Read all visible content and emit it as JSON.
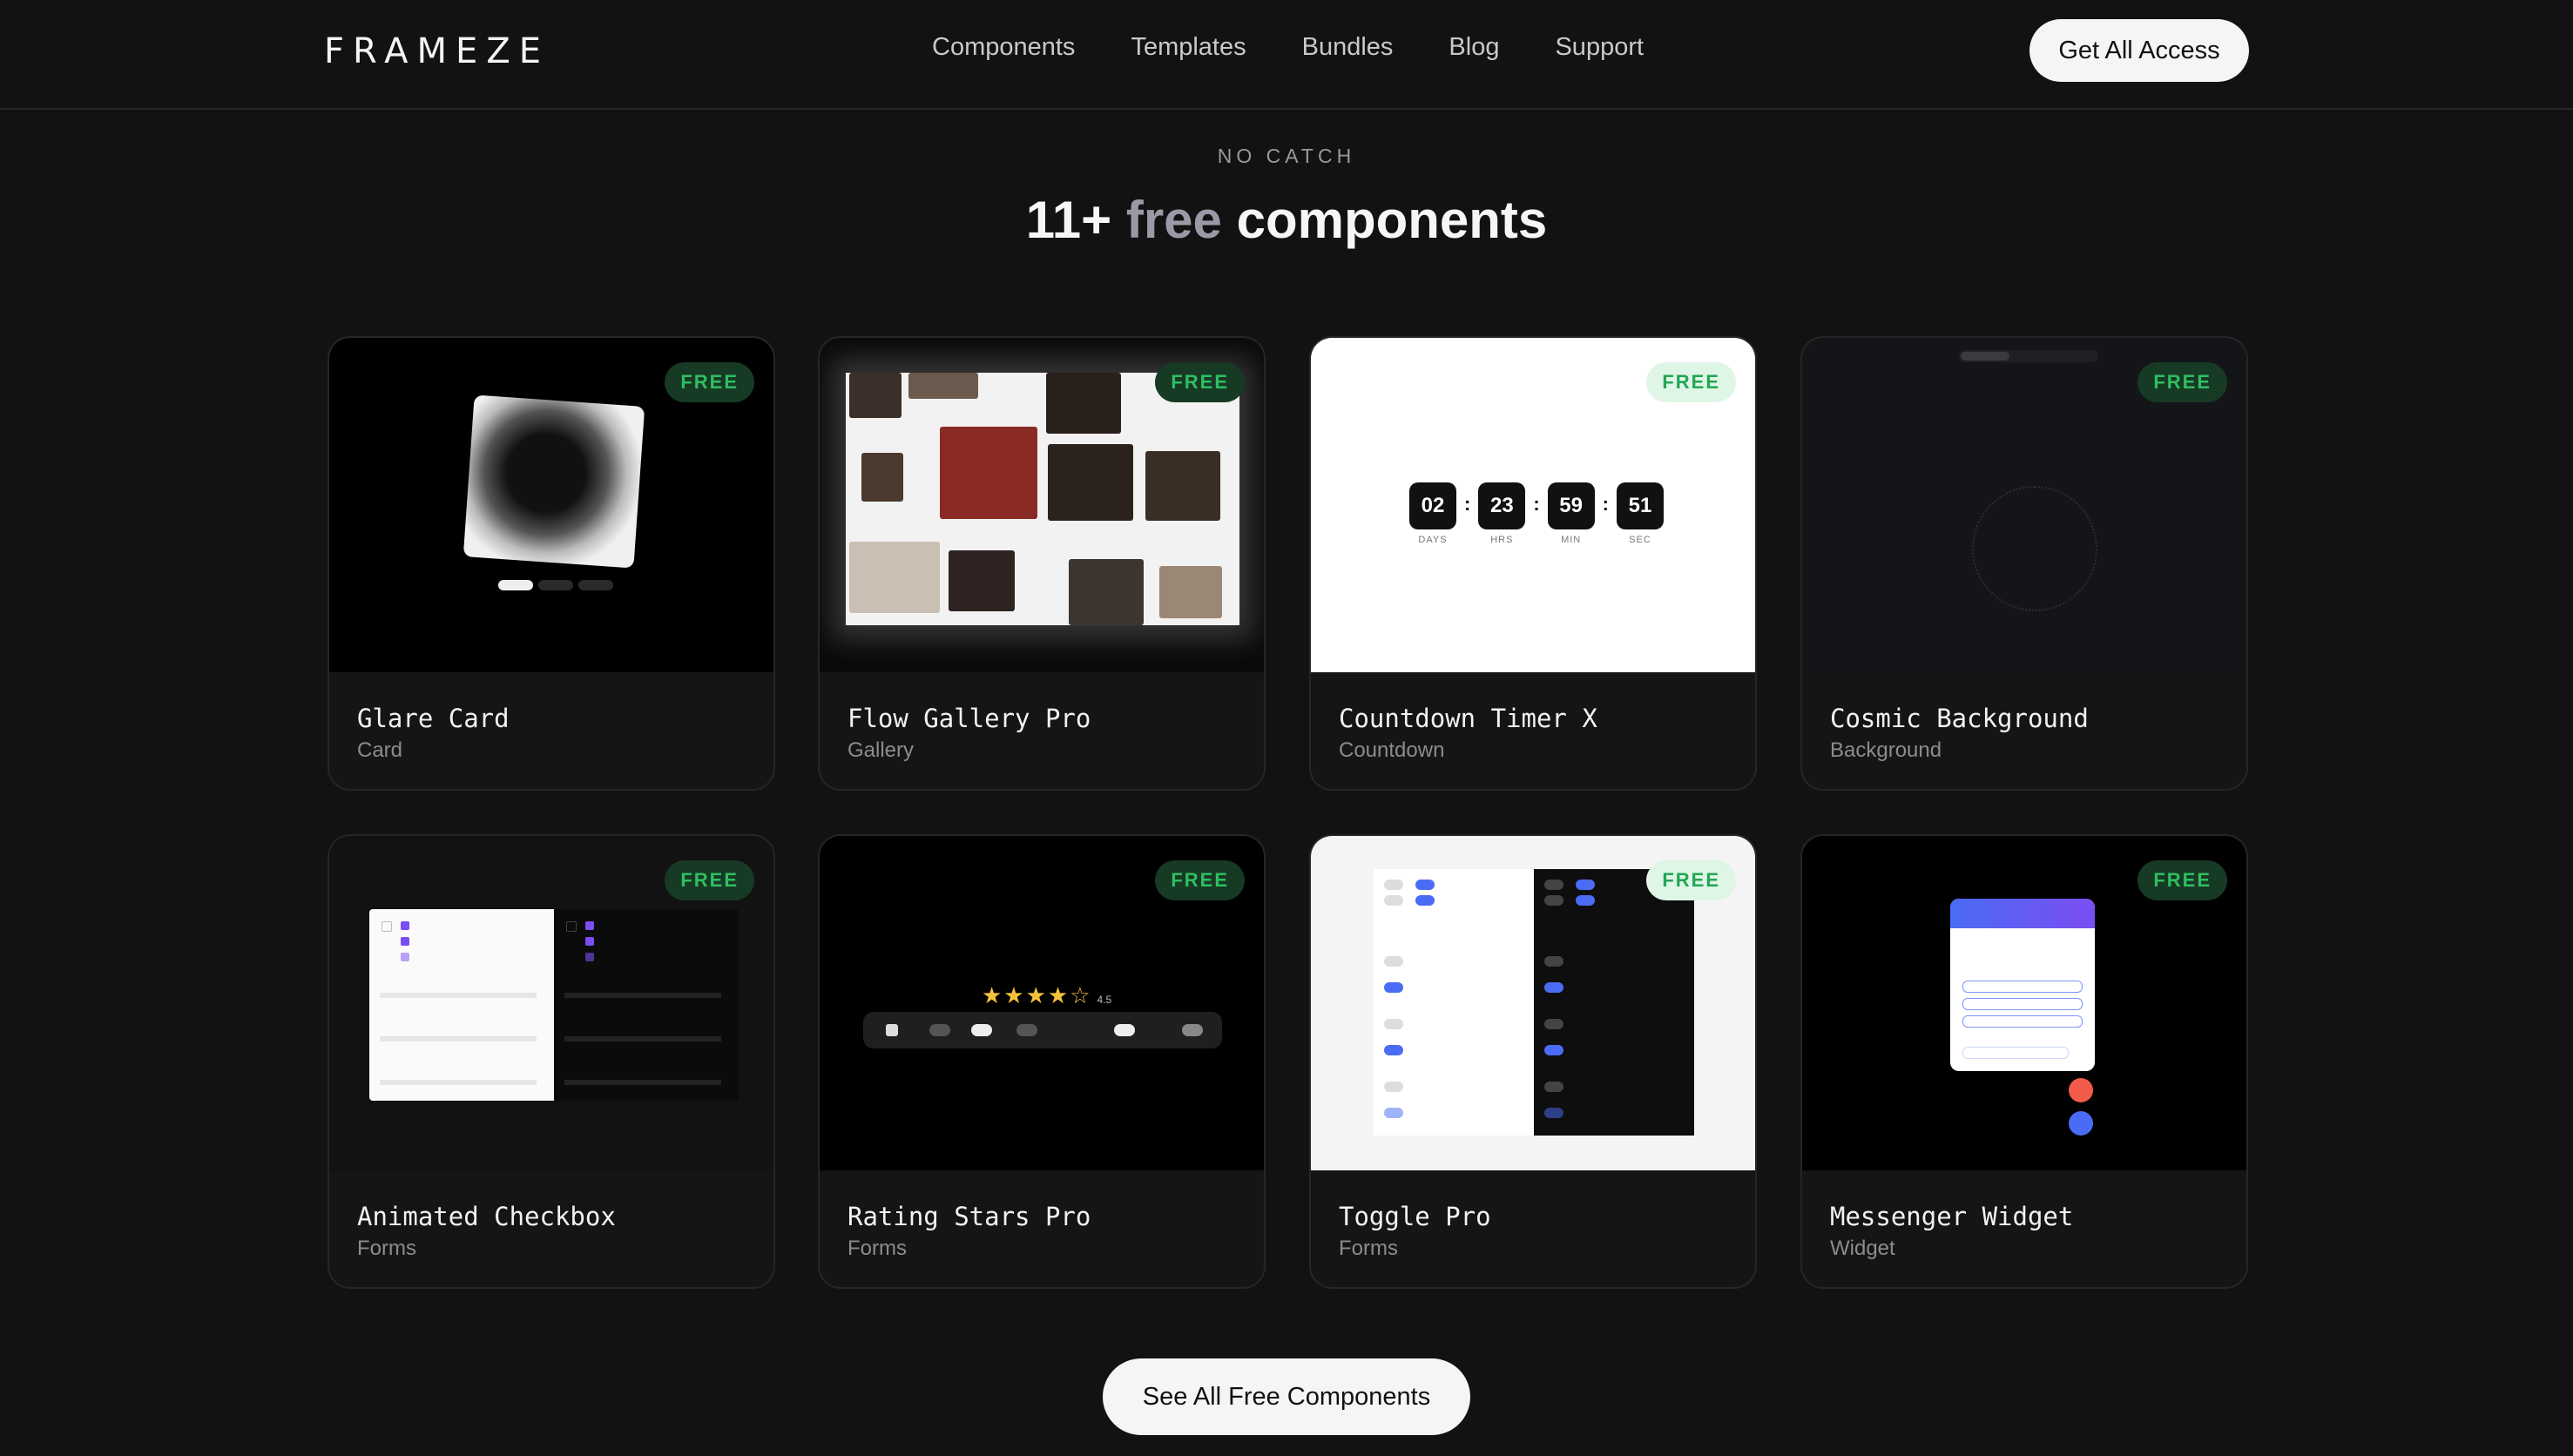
{
  "nav": {
    "logo": "FRAMEZE",
    "links": [
      "Components",
      "Templates",
      "Bundles",
      "Blog",
      "Support"
    ],
    "cta_label": "Get All Access"
  },
  "header": {
    "eyebrow": "NO CATCH",
    "headline_prefix": "11+",
    "headline_highlight": "free",
    "headline_suffix": "components"
  },
  "cards": [
    {
      "title": "Glare Card",
      "category": "Card",
      "badge": "FREE"
    },
    {
      "title": "Flow Gallery Pro",
      "category": "Gallery",
      "badge": "FREE"
    },
    {
      "title": "Countdown Timer X",
      "category": "Countdown",
      "badge": "FREE"
    },
    {
      "title": "Cosmic Background",
      "category": "Background",
      "badge": "FREE"
    },
    {
      "title": "Animated Checkbox",
      "category": "Forms",
      "badge": "FREE"
    },
    {
      "title": "Rating Stars Pro",
      "category": "Forms",
      "badge": "FREE"
    },
    {
      "title": "Toggle Pro",
      "category": "Forms",
      "badge": "FREE"
    },
    {
      "title": "Messenger Widget",
      "category": "Widget",
      "badge": "FREE"
    }
  ],
  "timer": {
    "days": "02",
    "hours": "23",
    "minutes": "59",
    "seconds": "51",
    "days_label": "DAYS",
    "hours_label": "HRS",
    "minutes_label": "MIN",
    "seconds_label": "SEC"
  },
  "stars": {
    "rating": "4.5"
  },
  "footer": {
    "see_all_label": "See All Free Components"
  },
  "colors": {
    "background": "#121212",
    "badge_green": "#2fbe62",
    "star_yellow": "#f5c33b",
    "chat_accent": "#4a6cf5"
  }
}
